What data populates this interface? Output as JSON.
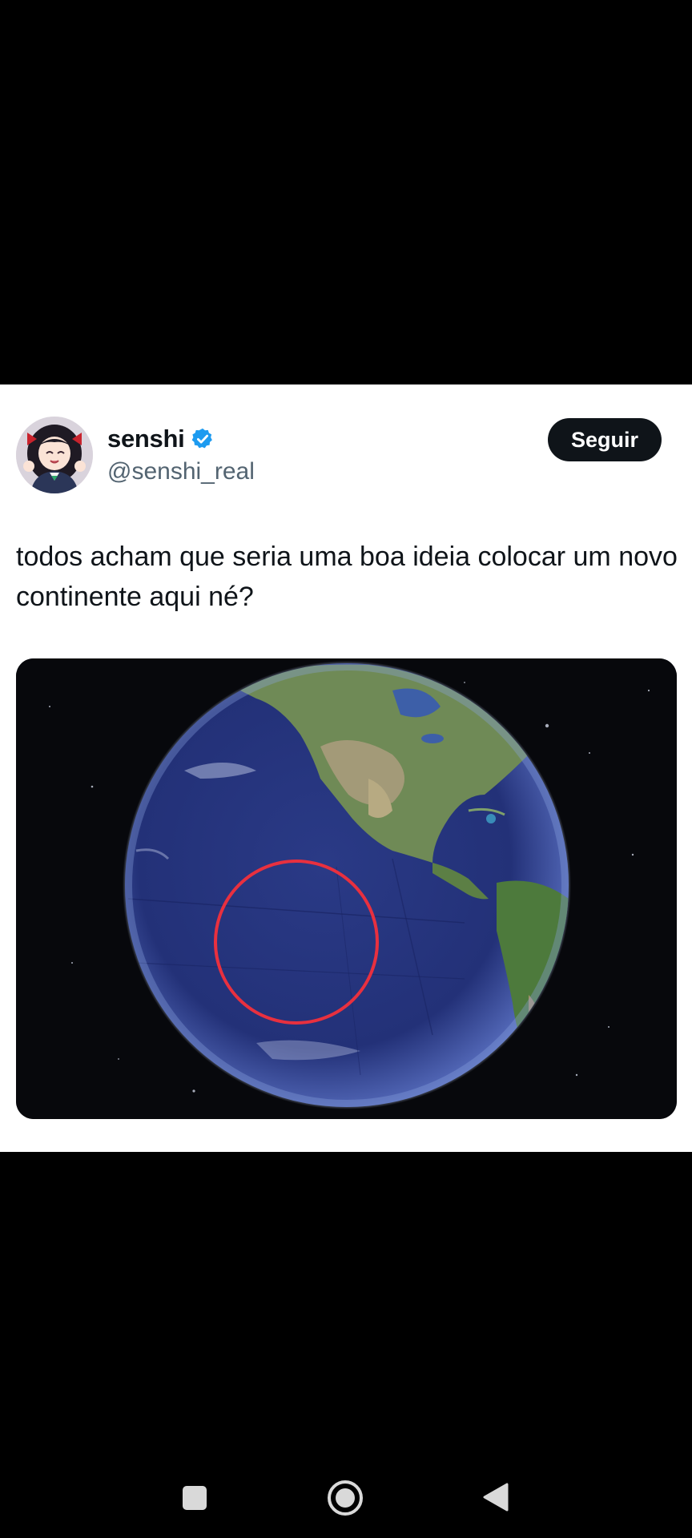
{
  "tweet": {
    "display_name": "senshi",
    "handle": "@senshi_real",
    "follow_label": "Seguir",
    "text": "todos acham que seria uma boa ideia colocar um novo continente aqui né?",
    "verified": true
  },
  "media": {
    "description_icon": "globe-image"
  },
  "colors": {
    "follow_bg": "#0f1419",
    "verified": "#1d9bf0",
    "handle": "#536471",
    "circle_annotation": "#e8303f"
  },
  "nav": {
    "recents_icon": "square-icon",
    "home_icon": "circle-home-icon",
    "back_icon": "triangle-back-icon"
  }
}
